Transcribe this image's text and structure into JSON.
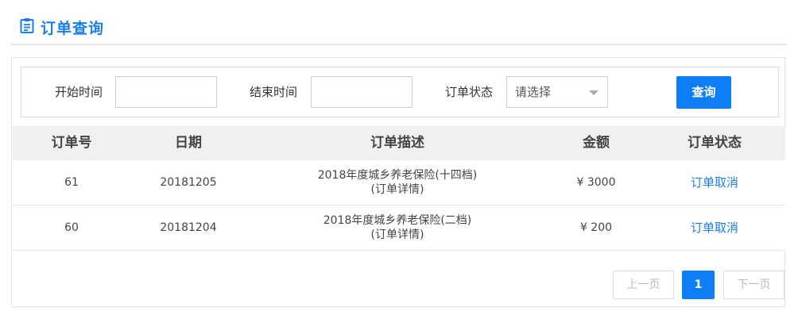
{
  "header": {
    "title": "订单查询",
    "icon": "clipboard-icon"
  },
  "filters": {
    "start_label": "开始时间",
    "start_value": "",
    "end_label": "结束时间",
    "end_value": "",
    "status_label": "订单状态",
    "status_selected": "请选择",
    "query_button": "查询"
  },
  "table": {
    "columns": [
      "订单号",
      "日期",
      "订单描述",
      "金额",
      "订单状态"
    ],
    "rows": [
      {
        "id": "61",
        "date": "20181205",
        "desc": "2018年度城乡养老保险(十四档)",
        "detail": "(订单详情)",
        "amount": "¥ 3000",
        "action": "订单取消"
      },
      {
        "id": "60",
        "date": "20181204",
        "desc": "2018年度城乡养老保险(二档)",
        "detail": "(订单详情)",
        "amount": "¥ 200",
        "action": "订单取消"
      }
    ]
  },
  "pagination": {
    "prev": "上一页",
    "current": "1",
    "next": "下一页"
  },
  "colors": {
    "accent": "#0d7ef5",
    "link": "#1a7fe6",
    "header_bg": "#f0f0f0"
  }
}
